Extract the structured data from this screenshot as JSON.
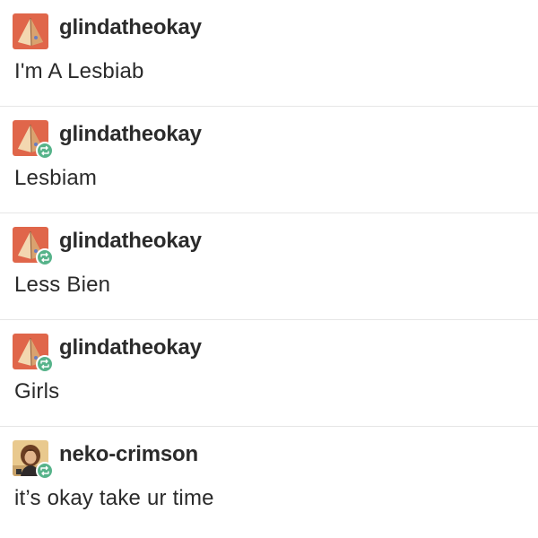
{
  "thread": {
    "posts": [
      {
        "username": "glindatheokay",
        "text": "I'm A Lesbiab",
        "avatar_icon": "pyramid-avatar-icon",
        "reblogged": false
      },
      {
        "username": "glindatheokay",
        "text": "Lesbiam",
        "avatar_icon": "pyramid-avatar-icon",
        "reblogged": true
      },
      {
        "username": "glindatheokay",
        "text": "Less Bien",
        "avatar_icon": "pyramid-avatar-icon",
        "reblogged": true
      },
      {
        "username": "glindatheokay",
        "text": "Girls",
        "avatar_icon": "pyramid-avatar-icon",
        "reblogged": true
      },
      {
        "username": "neko-crimson",
        "text": "it’s okay take ur time",
        "avatar_icon": "person-avatar-icon",
        "reblogged": true
      }
    ]
  },
  "colors": {
    "reblog_green": "#56b38a",
    "avatar_orange": "#e0664a",
    "divider": "#e6e6e6"
  }
}
